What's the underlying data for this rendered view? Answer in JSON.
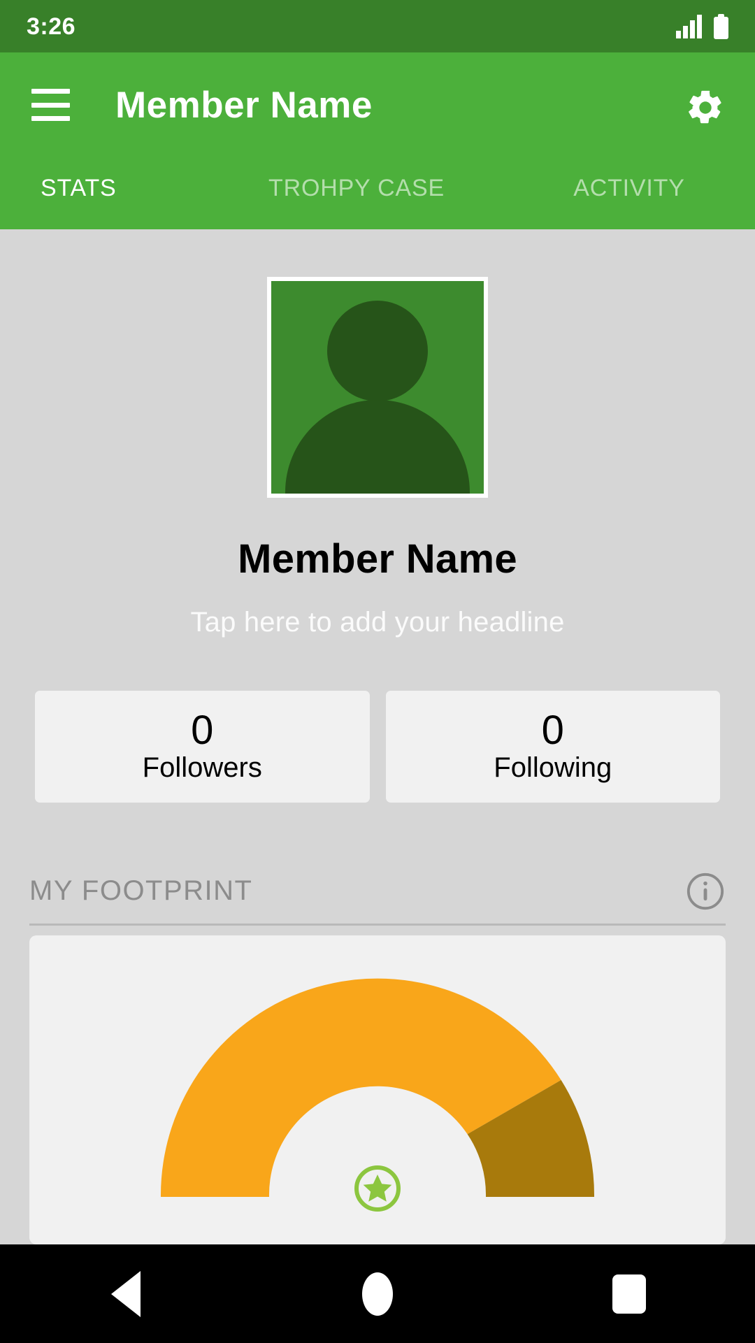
{
  "status_bar": {
    "time": "3:26",
    "signal_icon": "signal-bars-icon",
    "battery_icon": "battery-icon",
    "background": "#388029"
  },
  "app_bar": {
    "menu_icon": "hamburger-menu-icon",
    "title": "Member Name",
    "settings_icon": "gear-icon",
    "background": "#4cb03b"
  },
  "tabs": [
    {
      "label": "STATS",
      "active": true
    },
    {
      "label": "TROHPY CASE",
      "active": false
    },
    {
      "label": "ACTIVITY",
      "active": false
    }
  ],
  "profile": {
    "avatar_icon": "default-person-avatar",
    "name": "Member Name",
    "headline_placeholder": "Tap here to add your headline",
    "stats": [
      {
        "value": "0",
        "label": "Followers"
      },
      {
        "value": "0",
        "label": "Following"
      }
    ]
  },
  "footprint": {
    "section_title": "MY FOOTPRINT",
    "info_icon": "info-icon",
    "badge_icon": "star-badge-icon"
  },
  "nav_bar": {
    "back": "back-triangle-icon",
    "home": "home-circle-icon",
    "recents": "recents-square-icon",
    "background": "#000000"
  },
  "colors": {
    "brand_green": "#4cb03b",
    "dark_green": "#388029",
    "avatar_bg": "#3d8b2e",
    "avatar_fg": "#265419",
    "page_bg": "#d6d6d6",
    "card_bg": "#f1f1f1",
    "gauge_orange": "#f9a61a",
    "gauge_olive": "#a87a0c",
    "badge_green": "#8cc63f",
    "muted_text": "#8c8c8c"
  },
  "chart_data": {
    "type": "gauge",
    "title": "MY FOOTPRINT",
    "segments": [
      {
        "name": "primary",
        "color": "#f9a61a",
        "start_deg": 0,
        "end_deg": 148
      },
      {
        "name": "secondary",
        "color": "#a87a0c",
        "start_deg": 148,
        "end_deg": 180
      }
    ],
    "value_pct": 82,
    "range_deg": [
      0,
      180
    ],
    "center_badge": "star"
  }
}
